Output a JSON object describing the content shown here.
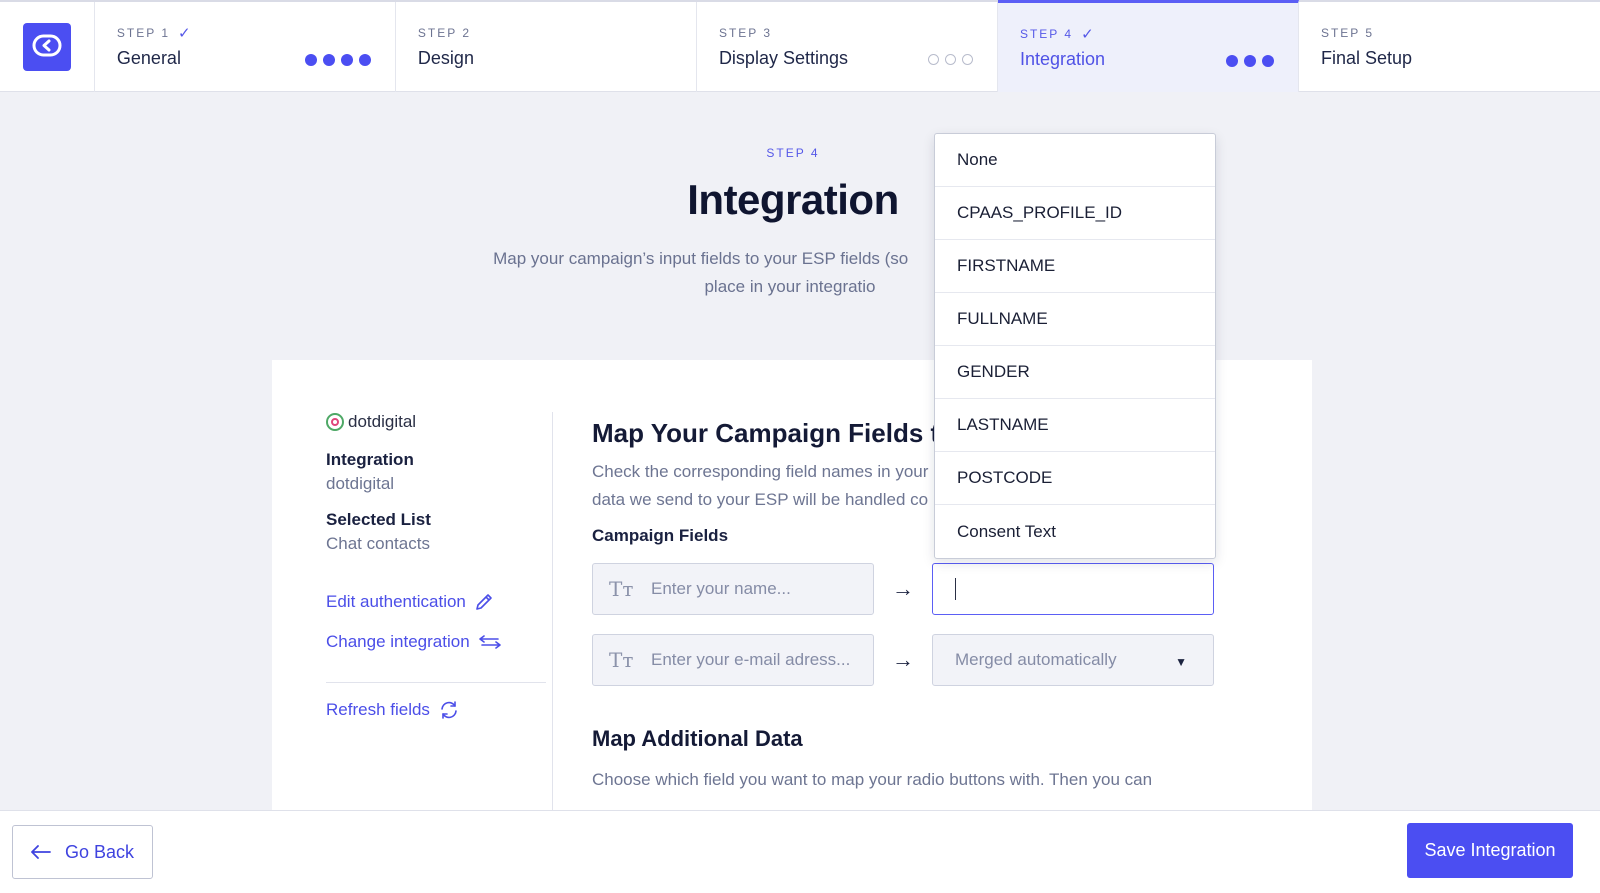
{
  "steps": [
    {
      "num": "STEP 1",
      "title": "General",
      "done": true
    },
    {
      "num": "STEP 2",
      "title": "Design",
      "done": false
    },
    {
      "num": "STEP 3",
      "title": "Display Settings",
      "done": false
    },
    {
      "num": "STEP 4",
      "title": "Integration",
      "done": true,
      "active": true
    },
    {
      "num": "STEP 5",
      "title": "Final Setup",
      "done": false
    }
  ],
  "header": {
    "step_label": "STEP 4",
    "title": "Integration",
    "description": "Map your campaign’s input fields to your ESP fields (so             sent to the right place in your integratio"
  },
  "sidebar": {
    "brand": "dotdigital",
    "integration_label": "Integration",
    "integration_value": "dotdigital",
    "list_label": "Selected List",
    "list_value": "Chat contacts",
    "edit_auth": "Edit authentication",
    "change_integration": "Change integration",
    "refresh_fields": "Refresh fields"
  },
  "main": {
    "title": "Map Your Campaign Fields to",
    "desc_line1": "Check the corresponding field names in your",
    "desc_line2": "data we send to your ESP will be handled co",
    "campaign_fields_label": "Campaign Fields",
    "field1_placeholder": "Enter your name...",
    "field2_placeholder": "Enter your e-mail adress...",
    "field2_target": "Merged automatically",
    "additional_title": "Map Additional Data",
    "additional_desc": "Choose which field you want to map your radio buttons with. Then you can"
  },
  "dropdown": {
    "options": [
      "None",
      "CPAAS_PROFILE_ID",
      "FIRSTNAME",
      "FULLNAME",
      "GENDER",
      "LASTNAME",
      "POSTCODE",
      "Consent Text"
    ]
  },
  "footer": {
    "back_label": "Go Back",
    "save_label": "Save Integration"
  },
  "colors": {
    "accent": "#4b4ef2",
    "background": "#f0f1f6"
  }
}
